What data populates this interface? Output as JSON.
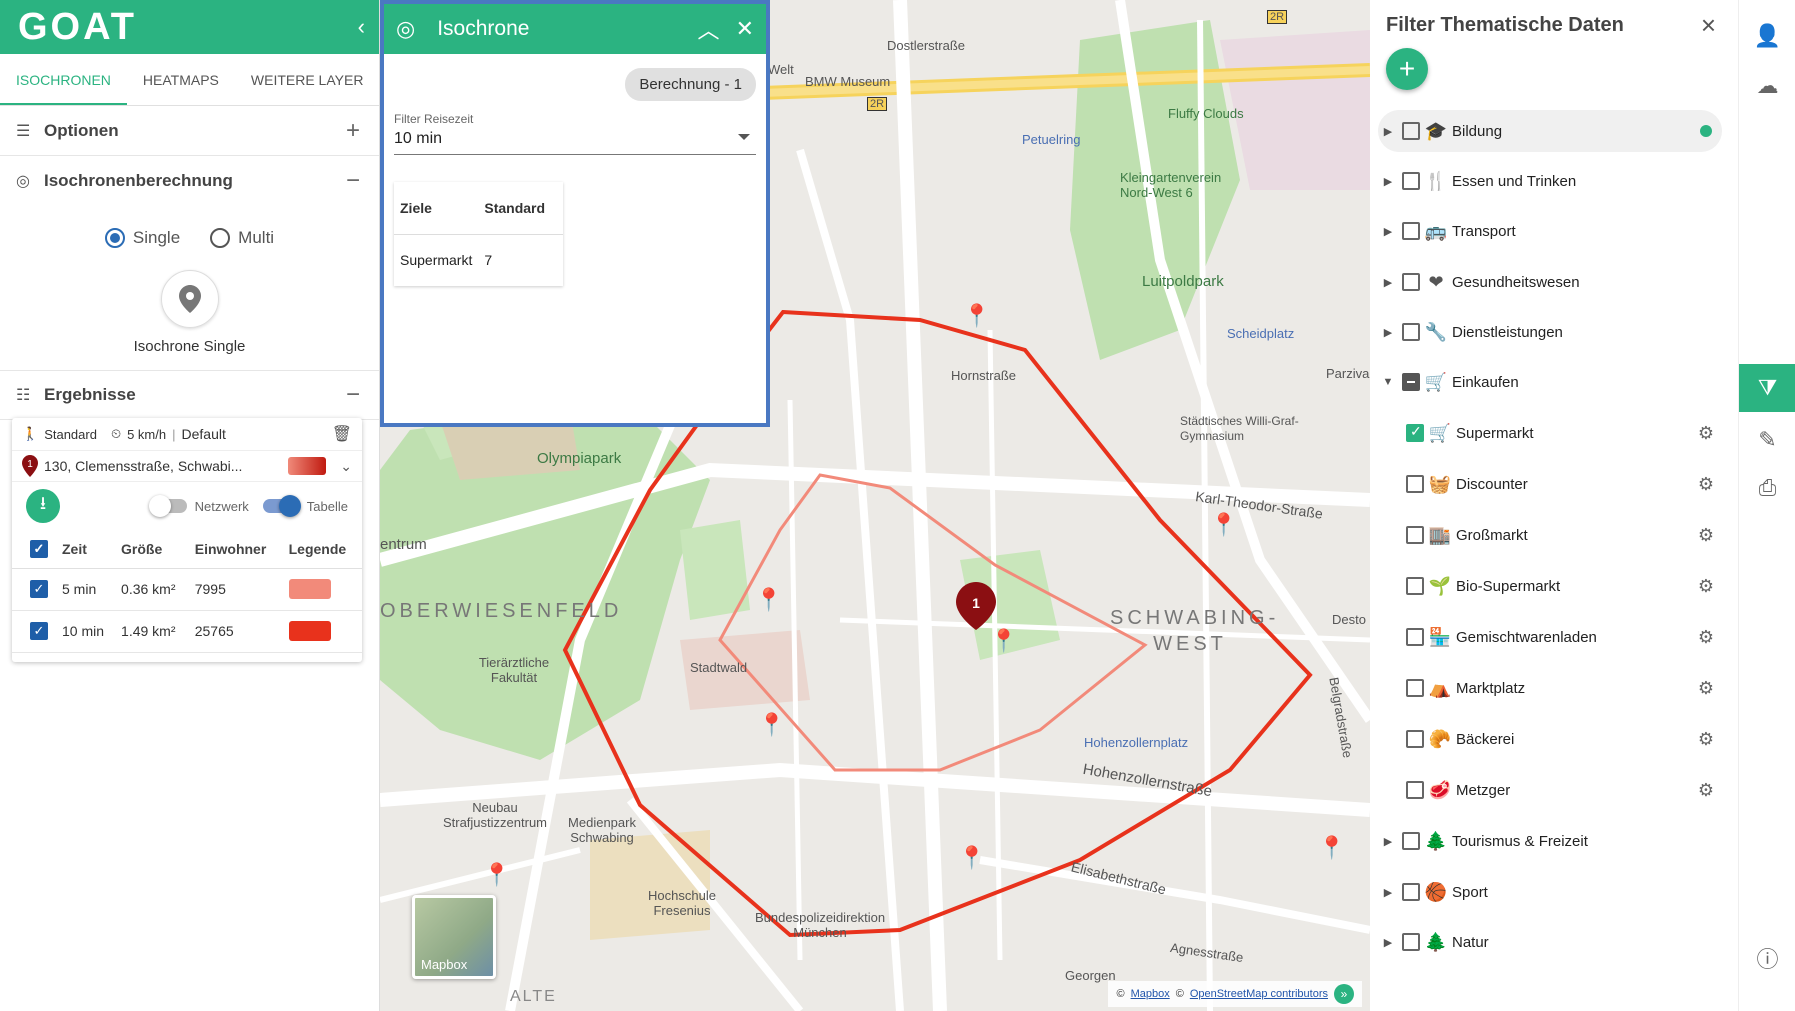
{
  "app": {
    "logo": "GOAT",
    "accent_color": "#2bb381"
  },
  "left": {
    "tabs": [
      "ISOCHRONEN",
      "HEATMAPS",
      "WEITERE LAYER"
    ],
    "optionen": {
      "title": "Optionen",
      "action": "+"
    },
    "berechnung": {
      "title": "Isochronenberechnung",
      "action": "−"
    },
    "mode": {
      "single": "Single",
      "multi": "Multi",
      "selected": "Single"
    },
    "pin_label": "Isochrone Single",
    "ergebnisse": {
      "title": "Ergebnisse",
      "action": "−"
    },
    "result": {
      "mode": "Standard",
      "speed": "5 km/h",
      "profile": "Default",
      "address": "130, Clemensstraße, Schwabi...",
      "marker_number": "1",
      "netzwerk": "Netzwerk",
      "tabelle": "Tabelle",
      "headers": [
        "Zeit",
        "Größe",
        "Einwohner",
        "Legende"
      ],
      "rows": [
        {
          "zeit": "5 min",
          "groesse": "0.36 km²",
          "einwohner": "7995",
          "color": "#f28a7a"
        },
        {
          "zeit": "10 min",
          "groesse": "1.49 km²",
          "einwohner": "25765",
          "color": "#e8321c"
        }
      ]
    }
  },
  "iso_popup": {
    "title": "Isochrone",
    "chip": "Berechnung - 1",
    "filter_label": "Filter Reisezeit",
    "filter_value": "10 min",
    "table_headers": [
      "Ziele",
      "Standard"
    ],
    "table_rows": [
      [
        "Supermarkt",
        "7"
      ]
    ]
  },
  "map": {
    "labels": {
      "dostlerstrasse": "Dostlerstraße",
      "bmw_museum": "BMW Museum",
      "welt": "Welt",
      "road_2r_a": "2R",
      "road_2r_b": "2R",
      "fluffy": "Fluffy Clouds",
      "petuelring": "Petuelring",
      "kleingarten": "Kleingartenverein Nord-West 6",
      "luitpoldpark": "Luitpoldpark",
      "scheidplatz": "Scheidplatz",
      "hornstrasse": "Hornstraße",
      "olympiapark": "Olympiapark",
      "gymnasium": "Städtisches Willi-Graf-Gymnasium",
      "karl_theodor": "Karl-Theodor-Straße",
      "oberwiesenfeld": "OBERWIESENFELD",
      "entrum": "entrum",
      "tieraerztliche": "Tierärztliche Fakultät",
      "stadtwald": "Stadtwald",
      "schwabing_west": "SCHWABING-WEST",
      "hohenzollernplatz": "Hohenzollernplatz",
      "hohenzollernstrasse": "Hohenzollernstraße",
      "neubau": "Neubau Strafjustizzentrum",
      "medienpark": "Medienpark Schwabing",
      "hochschule": "Hochschule Fresenius",
      "bundespolizei": "Bundespolizeidirektion München",
      "elisabethstrasse": "Elisabethstraße",
      "agnesstrasse": "Agnesstraße",
      "georgen": "Georgen",
      "alte": "ALTE",
      "parzival": "Parzival",
      "destou": "Desto",
      "belgradstrasse": "Belgradstraße",
      "mapbox_thumb": "Mapbox"
    },
    "attribution": {
      "copyright": "©",
      "mapbox": "Mapbox",
      "osm": "OpenStreetMap contributors",
      "expand": "»"
    },
    "isochrone_colors": {
      "outer": "#e8321c",
      "inner": "#f28a7a"
    }
  },
  "right": {
    "title": "Filter Thematische Daten",
    "close": "×",
    "add": "+",
    "categories": [
      {
        "label": "Bildung",
        "icon": "🎓",
        "state": "none",
        "expanded": false,
        "highlight": true,
        "dot": true
      },
      {
        "label": "Essen und Trinken",
        "icon": "🍴",
        "state": "none",
        "expanded": false
      },
      {
        "label": "Transport",
        "icon": "🚌",
        "state": "none",
        "expanded": false
      },
      {
        "label": "Gesundheitswesen",
        "icon": "❤",
        "state": "none",
        "expanded": false
      },
      {
        "label": "Dienstleistungen",
        "icon": "🔧",
        "state": "none",
        "expanded": false
      },
      {
        "label": "Einkaufen",
        "icon": "🛒",
        "state": "indeterminate",
        "expanded": true
      }
    ],
    "sub": [
      {
        "label": "Supermarkt",
        "icon": "🛒",
        "checked": true
      },
      {
        "label": "Discounter",
        "icon": "🧺",
        "checked": false
      },
      {
        "label": "Großmarkt",
        "icon": "🏬",
        "checked": false
      },
      {
        "label": "Bio-Supermarkt",
        "icon": "🌱",
        "checked": false
      },
      {
        "label": "Gemischtwarenladen",
        "icon": "🏪",
        "checked": false
      },
      {
        "label": "Marktplatz",
        "icon": "⛺",
        "checked": false
      },
      {
        "label": "Bäckerei",
        "icon": "🥐",
        "checked": false
      },
      {
        "label": "Metzger",
        "icon": "🥩",
        "checked": false
      }
    ],
    "bottom_categories": [
      {
        "label": "Tourismus & Freizeit",
        "icon": "🌲"
      },
      {
        "label": "Sport",
        "icon": "🏀"
      },
      {
        "label": "Natur",
        "icon": "🌲"
      }
    ]
  },
  "tools": {
    "account": "account-icon",
    "cloud": "cloud-icon",
    "filter": "filter-icon",
    "edit": "edit-icon",
    "print": "print-icon",
    "info": "info-icon"
  }
}
